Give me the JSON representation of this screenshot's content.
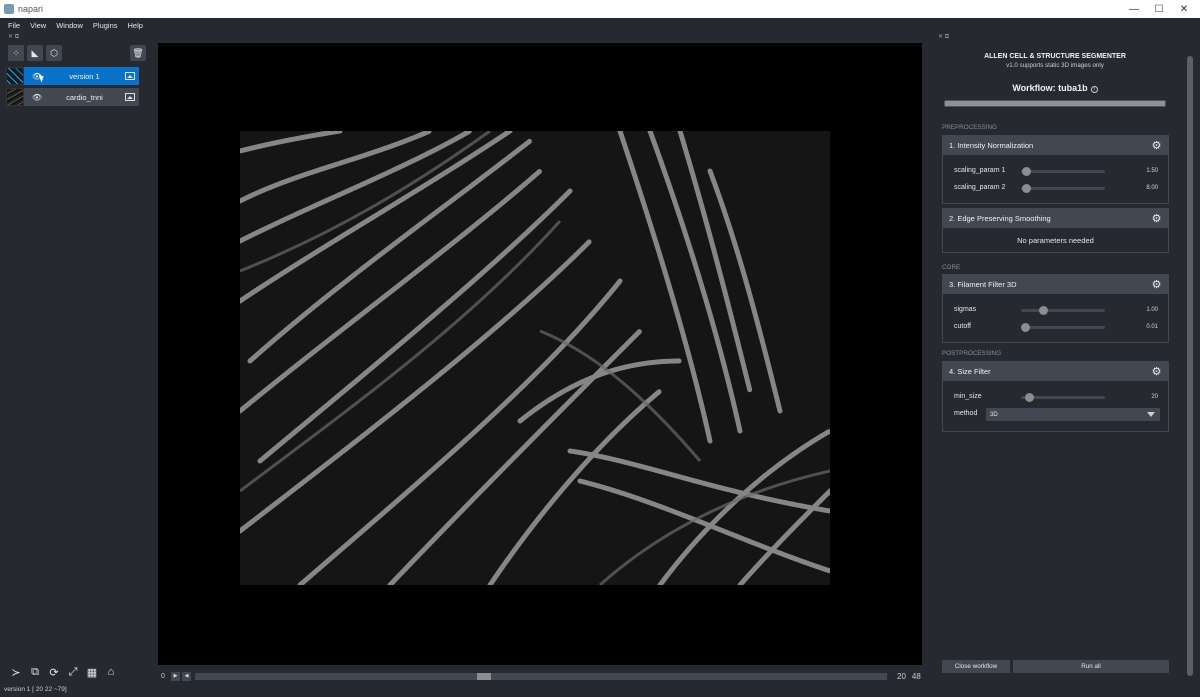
{
  "window": {
    "title": "napari",
    "minimize": "—",
    "maximize": "☐",
    "close": "✕"
  },
  "menu": [
    "File",
    "View",
    "Window",
    "Plugins",
    "Help"
  ],
  "layer_dock": {
    "header": "✕ ⧉"
  },
  "layer_tools": {
    "points_icon": "⁘",
    "shapes_icon": "◣",
    "labels_icon": "⬡",
    "trash_icon": "🗑"
  },
  "layers": [
    {
      "name": "version 1",
      "visible_icon": "👁",
      "selected": true
    },
    {
      "name": "cardio_tnni",
      "visible_icon": "👁",
      "selected": false
    }
  ],
  "viewer_buttons": {
    "console": "≻",
    "ndisplay": "⧉",
    "roll": "⟳",
    "transpose": "⤢",
    "grid": "▦",
    "home": "⌂"
  },
  "dims_slider": {
    "axis_index": "0",
    "play_back": "◀",
    "play_fwd": "▶",
    "current": "20",
    "max": "48",
    "fraction": 0.41
  },
  "status": "version 1 [ 20  22 ~79]",
  "plugin": {
    "header": "✕ ⧉",
    "title": "ALLEN CELL & STRUCTURE SEGMENTER",
    "subtitle": "v1.0 supports static 3D images only",
    "workflow_title": "Workflow: tuba1b",
    "info_icon": "i",
    "sections": {
      "preprocessing": "PREPROCESSING",
      "core": "CORE",
      "postprocessing": "POSTPROCESSING"
    },
    "steps": [
      {
        "label": "1. Intensity Normalization",
        "params": [
          {
            "name": "scaling_param 1",
            "value": "1.50",
            "fraction": 0.04
          },
          {
            "name": "scaling_param 2",
            "value": "8.00",
            "fraction": 0.04
          }
        ]
      },
      {
        "label": "2. Edge Preserving Smoothing",
        "note": "No parameters needed"
      },
      {
        "label": "3. Filament Filter 3D",
        "params": [
          {
            "name": "sigmas",
            "value": "1.00",
            "fraction": 0.26
          },
          {
            "name": "cutoff",
            "value": "0.01",
            "fraction": 0.01
          }
        ]
      },
      {
        "label": "4. Size Filter",
        "params": [
          {
            "name": "min_size",
            "value": "20",
            "fraction": 0.09
          }
        ],
        "method_label": "method",
        "method_value": "3D"
      }
    ],
    "gear_icon": "⚙",
    "close_workflow": "Close workflow",
    "run_all": "Run all"
  }
}
